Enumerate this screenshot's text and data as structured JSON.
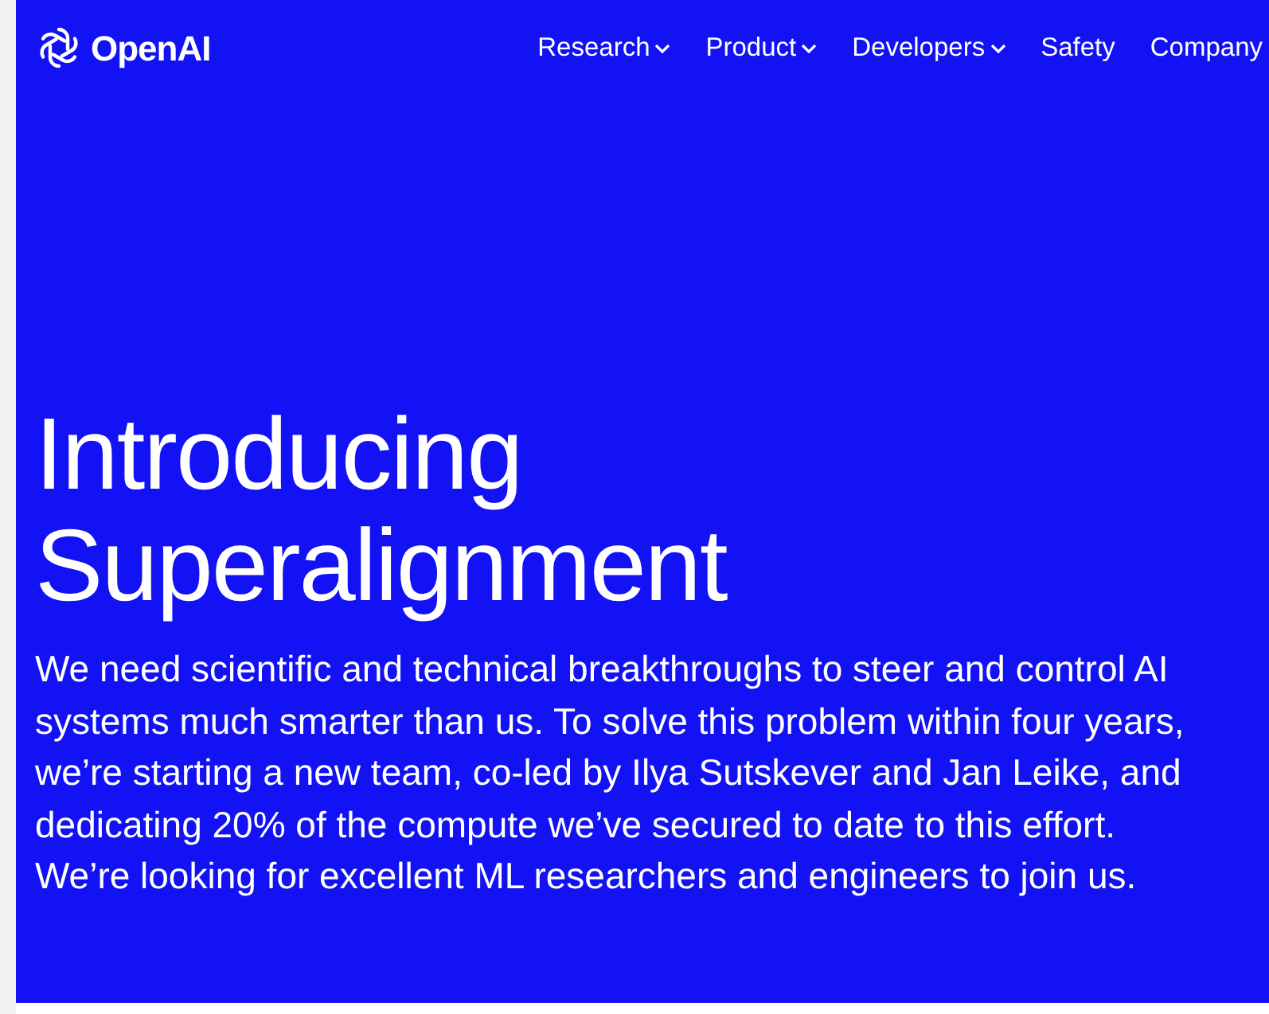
{
  "header": {
    "logo": "OpenAI",
    "nav": [
      {
        "label": "Research",
        "dropdown": true
      },
      {
        "label": "Product",
        "dropdown": true
      },
      {
        "label": "Developers",
        "dropdown": true
      },
      {
        "label": "Safety",
        "dropdown": false
      },
      {
        "label": "Company",
        "dropdown": false
      }
    ]
  },
  "hero": {
    "title": "Introducing Superalignment",
    "intro": "We need scientific and technical breakthroughs to steer and control AI systems much smarter than us. To solve this problem within four years, we’re starting a new team, co-led by Ilya Sutskever and Jan Leike, and dedicating 20% of the compute we’ve secured to date to this effort. We’re looking for excellent ML researchers and engineers to join us."
  }
}
